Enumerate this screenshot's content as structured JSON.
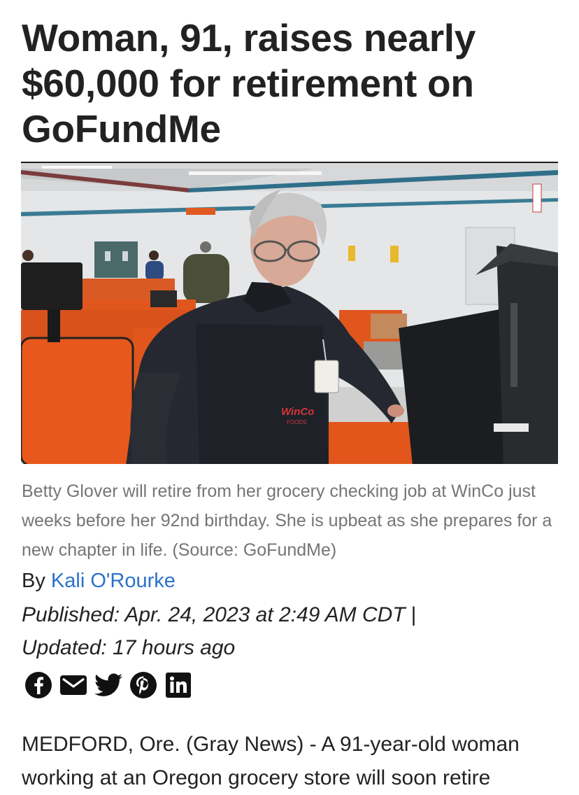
{
  "article": {
    "headline": "Woman, 91, raises nearly $60,000 for retirement on GoFundMe",
    "image_alt": "Betty Glover at a WinCo checkout counter",
    "photo_text": {
      "apron_logo": "WinCo",
      "apron_sub": "FOODS"
    },
    "caption": "Betty Glover will retire from her grocery checking job at WinCo just weeks before her 92nd birthday. She is upbeat as she prepares for a new chapter in life.  (Source: GoFundMe)",
    "byline_prefix": "By ",
    "author": "Kali O'Rourke",
    "published": "Published: Apr. 24, 2023 at 2:49 AM CDT",
    "published_separator": "|",
    "updated": "Updated: 17 hours ago",
    "share": [
      {
        "name": "facebook",
        "icon": "facebook-icon"
      },
      {
        "name": "email",
        "icon": "email-icon"
      },
      {
        "name": "twitter",
        "icon": "twitter-icon"
      },
      {
        "name": "pinterest",
        "icon": "pinterest-icon"
      },
      {
        "name": "linkedin",
        "icon": "linkedin-icon"
      }
    ],
    "body_first_paragraph": "MEDFORD, Ore. (Gray News) - A 91-year-old woman working at an Oregon grocery store will soon retire"
  },
  "colors": {
    "text": "#222222",
    "caption": "#757575",
    "link": "#2a72c9",
    "counter_orange": "#e0561d"
  }
}
